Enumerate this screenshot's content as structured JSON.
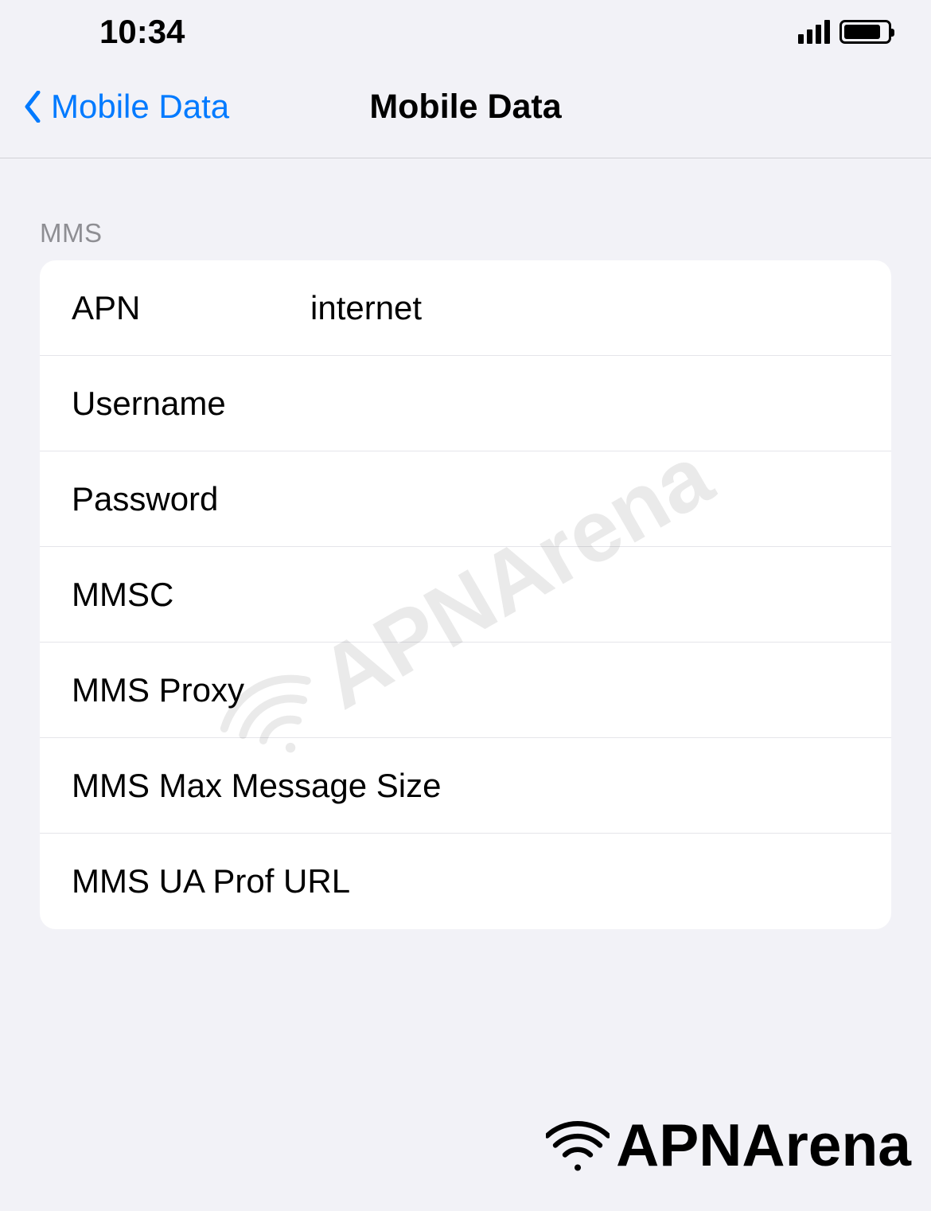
{
  "status": {
    "time": "10:34"
  },
  "nav": {
    "back_label": "Mobile Data",
    "title": "Mobile Data"
  },
  "section": {
    "header": "MMS"
  },
  "fields": {
    "apn": {
      "label": "APN",
      "value": "internet"
    },
    "username": {
      "label": "Username",
      "value": ""
    },
    "password": {
      "label": "Password",
      "value": ""
    },
    "mmsc": {
      "label": "MMSC",
      "value": ""
    },
    "mms_proxy": {
      "label": "MMS Proxy",
      "value": ""
    },
    "mms_max_size": {
      "label": "MMS Max Message Size",
      "value": ""
    },
    "mms_ua_prof": {
      "label": "MMS UA Prof URL",
      "value": ""
    }
  },
  "watermark": {
    "text": "APNArena"
  }
}
